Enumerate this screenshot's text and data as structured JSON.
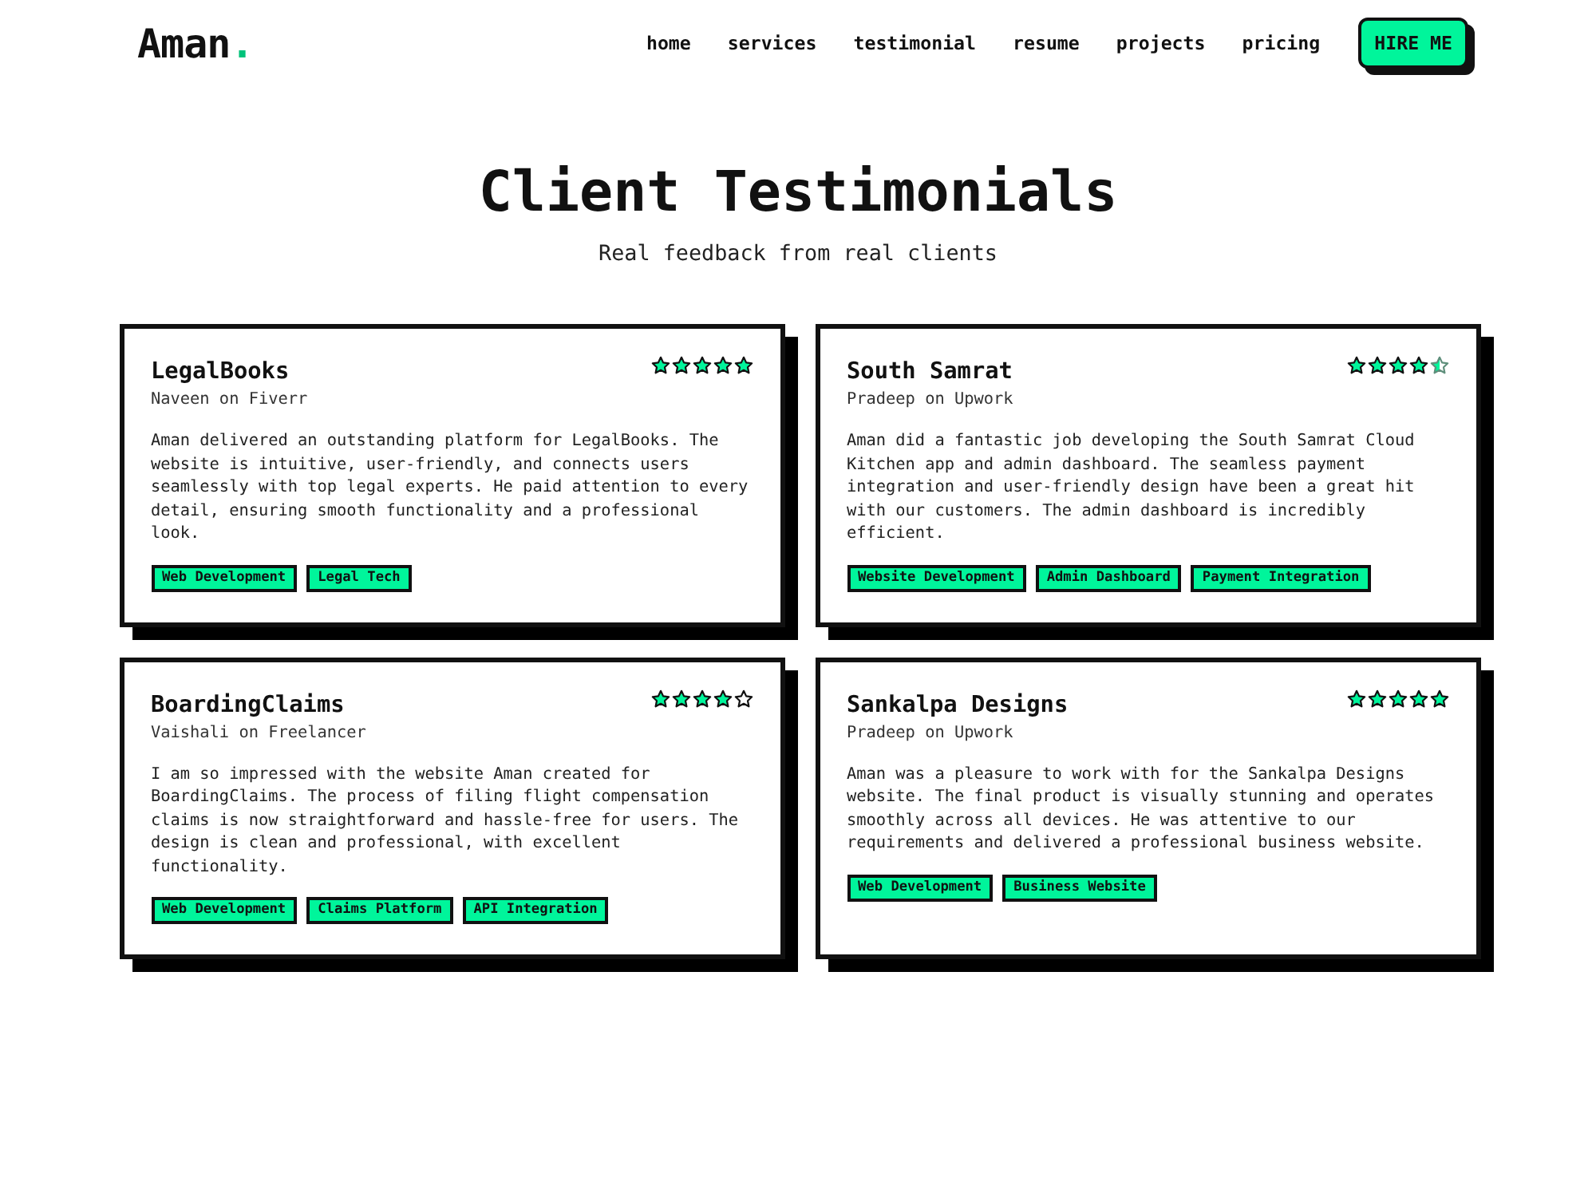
{
  "header": {
    "logo": {
      "name": "Aman",
      "mark": "."
    },
    "nav": [
      {
        "label": "home"
      },
      {
        "label": "services"
      },
      {
        "label": "testimonial"
      },
      {
        "label": "resume"
      },
      {
        "label": "projects"
      },
      {
        "label": "pricing"
      }
    ],
    "cta": "HIRE ME"
  },
  "section": {
    "title": "Client Testimonials",
    "subtitle": "Real feedback from real clients"
  },
  "testimonials": [
    {
      "project": "LegalBooks",
      "client": "Naveen on Fiverr",
      "stars": 5,
      "text": "Aman delivered an outstanding platform for LegalBooks. The website is intuitive, user-friendly, and connects users seamlessly with top legal experts. He paid attention to every detail, ensuring smooth functionality and a professional look.",
      "tags": [
        "Web Development",
        "Legal Tech"
      ]
    },
    {
      "project": "South Samrat",
      "client": "Pradeep on Upwork",
      "stars": 4.5,
      "text": "Aman did a fantastic job developing the South Samrat Cloud Kitchen app and admin dashboard. The seamless payment integration and user-friendly design have been a great hit with our customers. The admin dashboard is incredibly efficient.",
      "tags": [
        "Website Development",
        "Admin Dashboard",
        "Payment Integration"
      ]
    },
    {
      "project": "BoardingClaims",
      "client": "Vaishali on Freelancer",
      "stars": 4,
      "text": "I am so impressed with the website Aman created for BoardingClaims. The process of filing flight compensation claims is now straightforward and hassle-free for users. The design is clean and professional, with excellent functionality.",
      "tags": [
        "Web Development",
        "Claims Platform",
        "API Integration"
      ]
    },
    {
      "project": "Sankalpa Designs",
      "client": "Pradeep on Upwork",
      "stars": 5,
      "text": "Aman was a pleasure to work with for the Sankalpa Designs website. The final product is visually stunning and operates smoothly across all devices. He was attentive to our requirements and delivered a professional business website.",
      "tags": [
        "Web Development",
        "Business Website"
      ]
    }
  ]
}
